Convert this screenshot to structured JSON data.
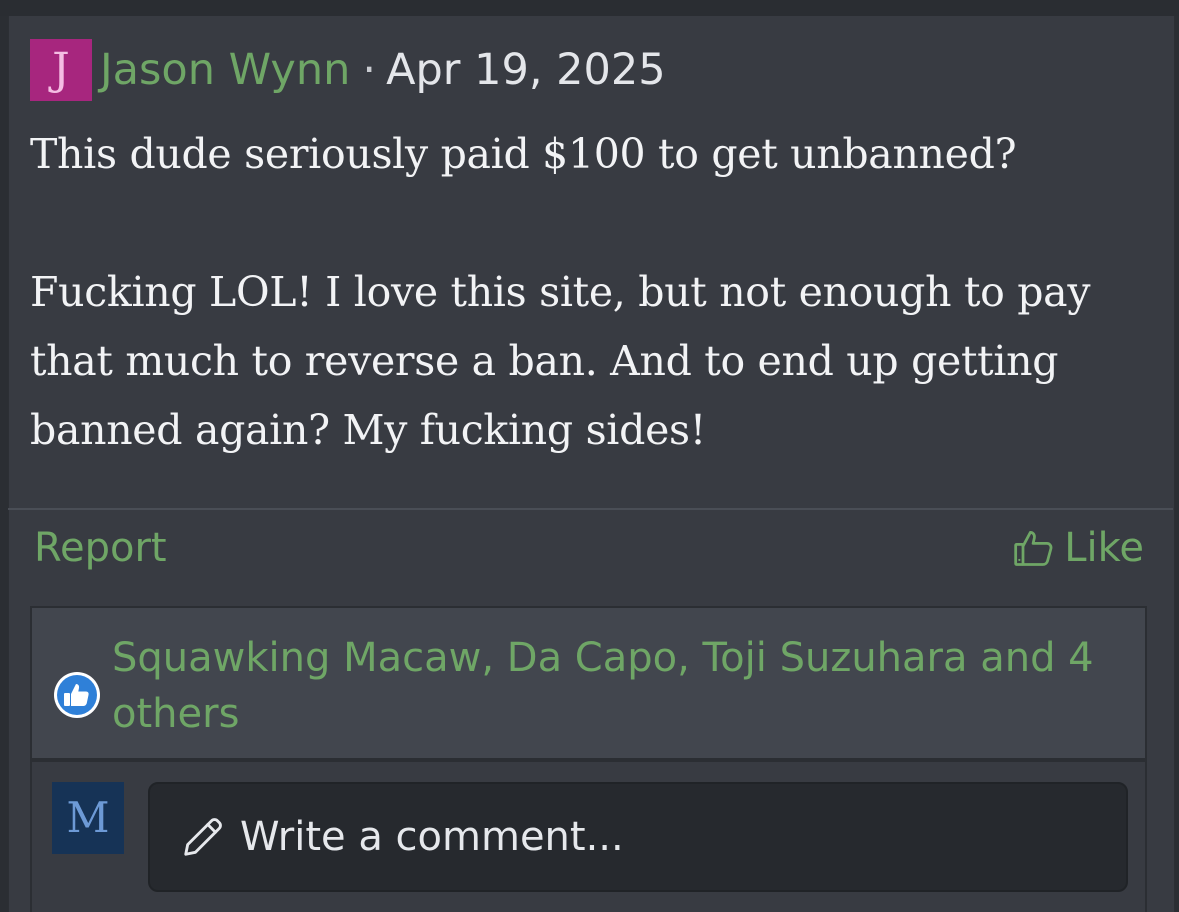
{
  "post": {
    "author_initial": "J",
    "author": "Jason Wynn",
    "separator": "·",
    "date": "Apr 19, 2025",
    "paragraphs": [
      "This dude seriously paid $100 to get unbanned?",
      "Fucking LOL! I love this site, but not enough to pay that much to reverse a ban. And to end up getting banned again? My fucking sides!"
    ]
  },
  "actions": {
    "report_label": "Report",
    "like_label": "Like",
    "like_icon": "thumbs-up-outline-icon"
  },
  "reactions": {
    "icon": "thumbs-up-badge-icon",
    "names": "Squawking Macaw, Da Capo, Toji Suzuhara and 4 others"
  },
  "comment": {
    "user_initial": "M",
    "placeholder": "Write a comment...",
    "icon": "pencil-icon"
  },
  "colors": {
    "accent": "#6fa666",
    "author_avatar_bg": "#a7267e",
    "user_avatar_bg": "#163356",
    "reaction_badge": "#2f80d8"
  }
}
